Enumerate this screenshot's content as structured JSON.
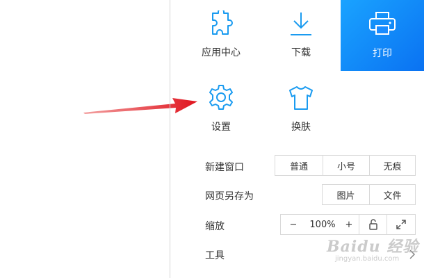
{
  "tiles": [
    {
      "id": "apps",
      "label": "应用中心",
      "icon": "puzzle-icon",
      "active": false
    },
    {
      "id": "download",
      "label": "下载",
      "icon": "download-icon",
      "active": false
    },
    {
      "id": "print",
      "label": "打印",
      "icon": "printer-icon",
      "active": true
    },
    {
      "id": "settings",
      "label": "设置",
      "icon": "gear-icon",
      "active": false
    },
    {
      "id": "skin",
      "label": "换肤",
      "icon": "tshirt-icon",
      "active": false
    }
  ],
  "rows": {
    "new_window": {
      "label": "新建窗口",
      "options": [
        "普通",
        "小号",
        "无痕"
      ]
    },
    "save_as": {
      "label": "网页另存为",
      "options": [
        "图片",
        "文件"
      ]
    },
    "zoom": {
      "label": "缩放",
      "minus": "−",
      "value": "100%",
      "plus": "+"
    },
    "tools": {
      "label": "工具"
    }
  },
  "watermark": {
    "brand": "Baidu 经验",
    "url": "jingyan.baidu.com"
  },
  "colors": {
    "accent": "#1a8cff",
    "icon": "#1a9bf0",
    "arrow": "#e0141e"
  }
}
